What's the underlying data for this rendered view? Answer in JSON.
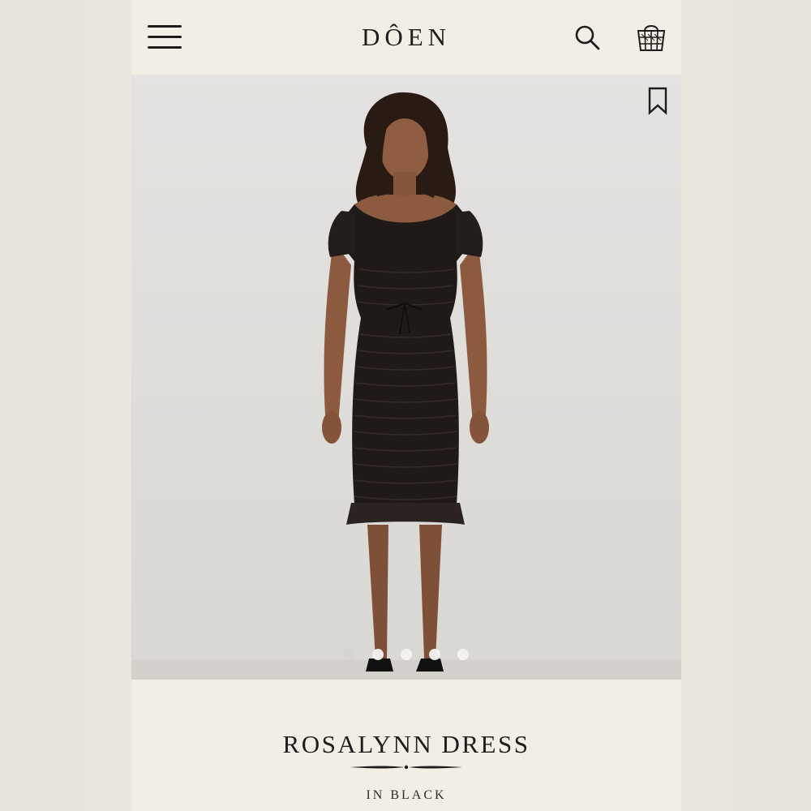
{
  "header": {
    "logo": "DÔEN",
    "menu_icon": "hamburger-menu-icon",
    "search_icon": "search-icon",
    "bag_icon": "shopping-basket-icon"
  },
  "hero": {
    "bookmark_icon": "bookmark-icon",
    "image_count": 5,
    "active_image_index": 0
  },
  "product": {
    "name": "ROSALYNN DRESS",
    "color_label": "IN BLACK"
  },
  "colors": {
    "page_bg": "#f2eee5",
    "text": "#1d1d1d",
    "hero_bg": "#e0dfdc",
    "dress": "#1f1a18",
    "skin": "#8a5a40"
  }
}
